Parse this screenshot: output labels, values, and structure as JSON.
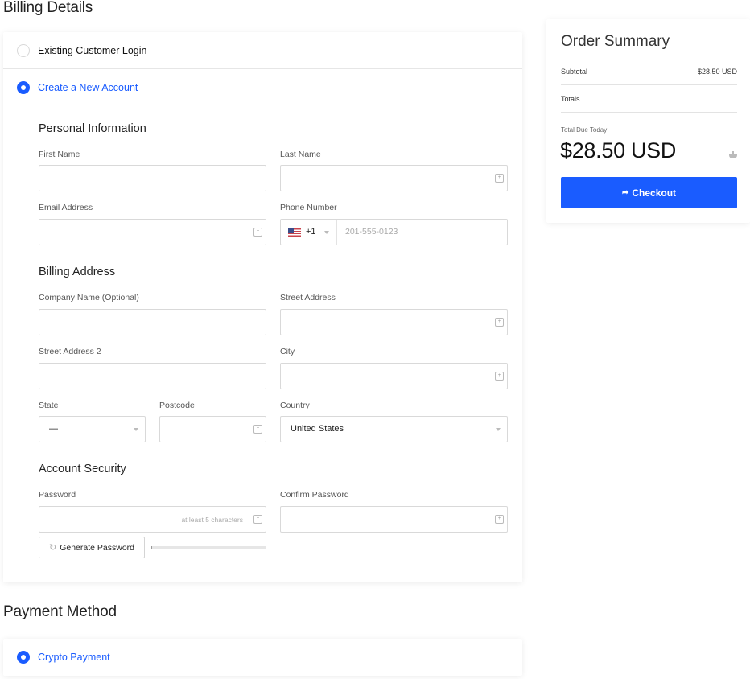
{
  "billing": {
    "title": "Billing Details",
    "options": [
      {
        "label": "Existing Customer Login",
        "selected": false
      },
      {
        "label": "Create a New Account",
        "selected": true
      }
    ],
    "personal": {
      "heading": "Personal Information",
      "first_name_label": "First Name",
      "last_name_label": "Last Name",
      "email_label": "Email Address",
      "phone_label": "Phone Number",
      "phone_dial_code": "+1",
      "phone_country_icon": "us-flag-icon",
      "phone_placeholder": "201-555-0123"
    },
    "address": {
      "heading": "Billing Address",
      "company_label": "Company Name (Optional)",
      "street_label": "Street Address",
      "street2_label": "Street Address 2",
      "city_label": "City",
      "state_label": "State",
      "state_value": "—",
      "postcode_label": "Postcode",
      "country_label": "Country",
      "country_value": "United States"
    },
    "security": {
      "heading": "Account Security",
      "password_label": "Password",
      "password_placeholder": "at least 5 characters",
      "confirm_label": "Confirm Password",
      "generate_label": "Generate Password",
      "strength_percent": 1
    }
  },
  "payment": {
    "title": "Payment Method",
    "options": [
      {
        "label": "Crypto Payment",
        "selected": true
      }
    ]
  },
  "summary": {
    "title": "Order Summary",
    "subtotal_label": "Subtotal",
    "subtotal_value": "$28.50 USD",
    "totals_label": "Totals",
    "due_label": "Total Due Today",
    "due_amount": "$28.50 USD",
    "checkout_label": "Checkout"
  },
  "colors": {
    "accent": "#1a5cff"
  }
}
